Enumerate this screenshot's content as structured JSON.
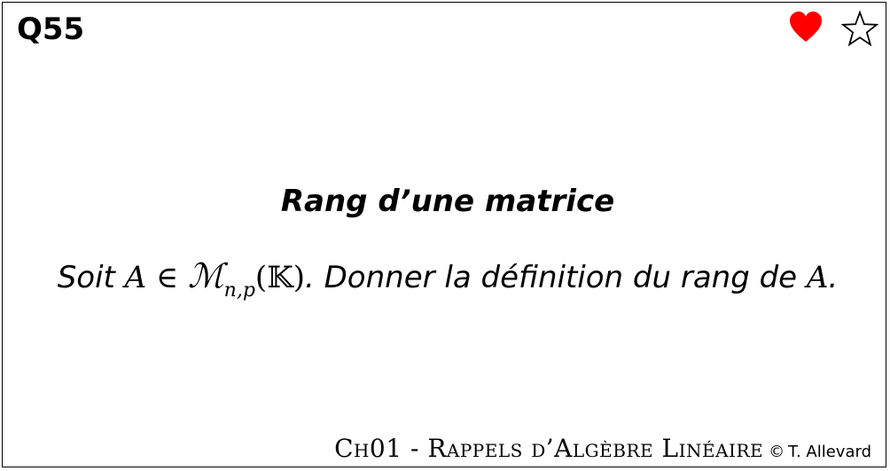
{
  "card": {
    "number": "Q55",
    "icons": {
      "heart": "heart-icon",
      "star": "star-outline-icon"
    },
    "colors": {
      "heart": "#ff0000",
      "border": "#000000"
    }
  },
  "content": {
    "title": "Rang d’une matrice",
    "question": {
      "soit": "Soit ",
      "var_a": "A",
      "in": " ∈ ",
      "script_m": "ℳ",
      "subscript": "n,p",
      "paren_open": "(",
      "field": "𝕂",
      "paren_close": ")",
      "rest": ". Donner la définition du rang de ",
      "var_a2": "A",
      "period": "."
    }
  },
  "footer": {
    "chapter": "Ch01 - Rappels d’Algèbre Linéaire",
    "copyright": "©",
    "author": "T. Allevard"
  }
}
